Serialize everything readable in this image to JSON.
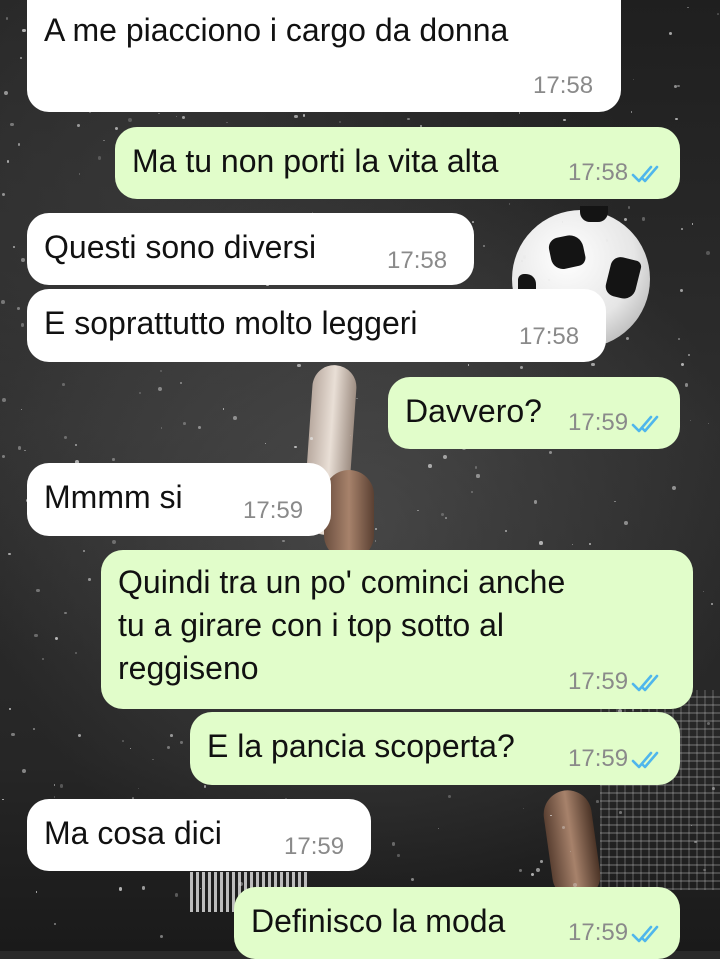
{
  "colors": {
    "incoming_bubble": "#ffffff",
    "outgoing_bubble": "#e1fdca",
    "read_tick": "#4fb6ec",
    "timestamp": "#8a8a8a"
  },
  "wallpaper": {
    "icons": [
      "soccer-ball-icon"
    ]
  },
  "messages": [
    {
      "direction": "in",
      "text": "A me piacciono i cargo da donna",
      "time": "17:58"
    },
    {
      "direction": "out",
      "text": "Ma tu non porti la vita alta",
      "time": "17:58",
      "status": "read-double-check-icon"
    },
    {
      "direction": "in",
      "text": "Questi sono diversi",
      "time": "17:58"
    },
    {
      "direction": "in",
      "text": "E soprattutto molto leggeri",
      "time": "17:58"
    },
    {
      "direction": "out",
      "text": "Davvero?",
      "time": "17:59",
      "status": "read-double-check-icon"
    },
    {
      "direction": "in",
      "text": "Mmmm si",
      "time": "17:59"
    },
    {
      "direction": "out",
      "lines": [
        "Quindi tra un po' cominci anche",
        "tu a girare con i top sotto al",
        "reggiseno"
      ],
      "time": "17:59",
      "status": "read-double-check-icon"
    },
    {
      "direction": "out",
      "text": "E la pancia scoperta?",
      "time": "17:59",
      "status": "read-double-check-icon"
    },
    {
      "direction": "in",
      "text": "Ma cosa dici",
      "time": "17:59"
    },
    {
      "direction": "out",
      "text": "Definisco la moda",
      "time": "17:59",
      "status": "read-double-check-icon"
    }
  ]
}
